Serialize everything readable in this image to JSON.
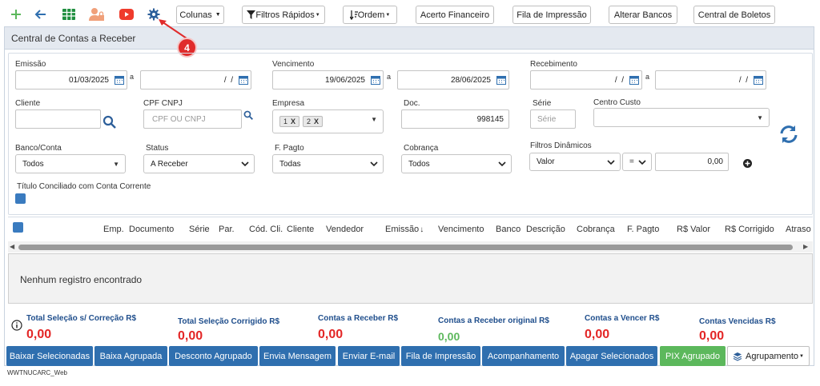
{
  "toolbar": {
    "icons": {
      "add": "plus-icon",
      "back": "arrow-left-icon",
      "excel": "spreadsheet-icon",
      "users": "user-lock-icon",
      "video": "youtube-icon",
      "settings": "gear-icon"
    },
    "colunas": "Colunas",
    "filtros_rapidos": "Filtros Rápidos",
    "ordem": "Ordem",
    "acerto_financeiro": "Acerto Financeiro",
    "fila_impressao": "Fila de Impressão",
    "alterar_bancos": "Alterar Bancos",
    "central_boletos": "Central de Boletos"
  },
  "annotation": {
    "number": "4"
  },
  "panel": {
    "title": "Central de Contas a Receber"
  },
  "filters": {
    "emissao": {
      "label": "Emissão",
      "from": "01/03/2025",
      "to": "  /  /",
      "sep": "a"
    },
    "vencimento": {
      "label": "Vencimento",
      "from": "19/06/2025",
      "to": "28/06/2025",
      "sep": "a"
    },
    "recebimento": {
      "label": "Recebimento",
      "from": "  /  /",
      "to": "  /  /",
      "sep": "a"
    },
    "cliente": {
      "label": "Cliente",
      "value": ""
    },
    "cpf_cnpj": {
      "label": "CPF CNPJ",
      "placeholder": "CPF OU CNPJ"
    },
    "empresa": {
      "label": "Empresa",
      "chips": [
        "1",
        "2"
      ],
      "chip_close": "X"
    },
    "doc": {
      "label": "Doc.",
      "value": "998145"
    },
    "serie": {
      "label": "Série",
      "placeholder": "Série"
    },
    "centro_custo": {
      "label": "Centro Custo",
      "value": ""
    },
    "banco_conta": {
      "label": "Banco/Conta",
      "value": "Todos"
    },
    "status": {
      "label": "Status",
      "value": "A Receber"
    },
    "f_pagto": {
      "label": "F. Pagto",
      "value": "Todas"
    },
    "cobranca": {
      "label": "Cobrança",
      "value": "Todos"
    },
    "filtros_dinamicos": {
      "label": "Filtros Dinâmicos",
      "field": "Valor",
      "operator": "=",
      "value": "0,00"
    },
    "titulo_conciliado": {
      "label": "Título Conciliado com Conta Corrente"
    }
  },
  "table": {
    "columns": [
      "Emp.",
      "Documento",
      "Série",
      "Par.",
      "Cód. Cli.",
      "Cliente",
      "Vendedor",
      "Emissão",
      "Vencimento",
      "Banco",
      "Descrição",
      "Cobrança",
      "F. Pagto",
      "R$ Valor",
      "R$ Corrigido",
      "Atraso"
    ],
    "empty": "Nenhum registro encontrado"
  },
  "totals": [
    {
      "label": "Total Seleção s/ Correção R$",
      "value": "0,00"
    },
    {
      "label": "Total Seleção Corrigido R$",
      "value": "0,00"
    },
    {
      "label": "Contas a Receber R$",
      "value": "0,00"
    },
    {
      "label": "Contas a Receber original R$",
      "value": "0,00"
    },
    {
      "label": "Contas a Vencer R$",
      "value": "0,00"
    },
    {
      "label": "Contas Vencidas R$",
      "value": "0,00"
    }
  ],
  "actions": {
    "baixar_selecionadas": "Baixar Selecionadas",
    "baixa_agrupada": "Baixa Agrupada",
    "desconto_agrupado": "Desconto Agrupado",
    "envia_mensagem": "Envia Mensagem",
    "enviar_email": "Enviar E-mail",
    "fila_impressao": "Fila de Impressão",
    "acompanhamento": "Acompanhamento",
    "apagar_selecionados": "Apagar Selecionados",
    "pix_agrupado": "PIX Agrupado",
    "agrupamento": "Agrupamento"
  },
  "footer": {
    "program": "WWTNUCARC_Web"
  },
  "colors": {
    "primary_button": "#2f6faf",
    "pix_button": "#5cb85c",
    "total_value": "#e32626",
    "total_value_original": "#5cb85c",
    "annotation": "#e02b2b"
  }
}
